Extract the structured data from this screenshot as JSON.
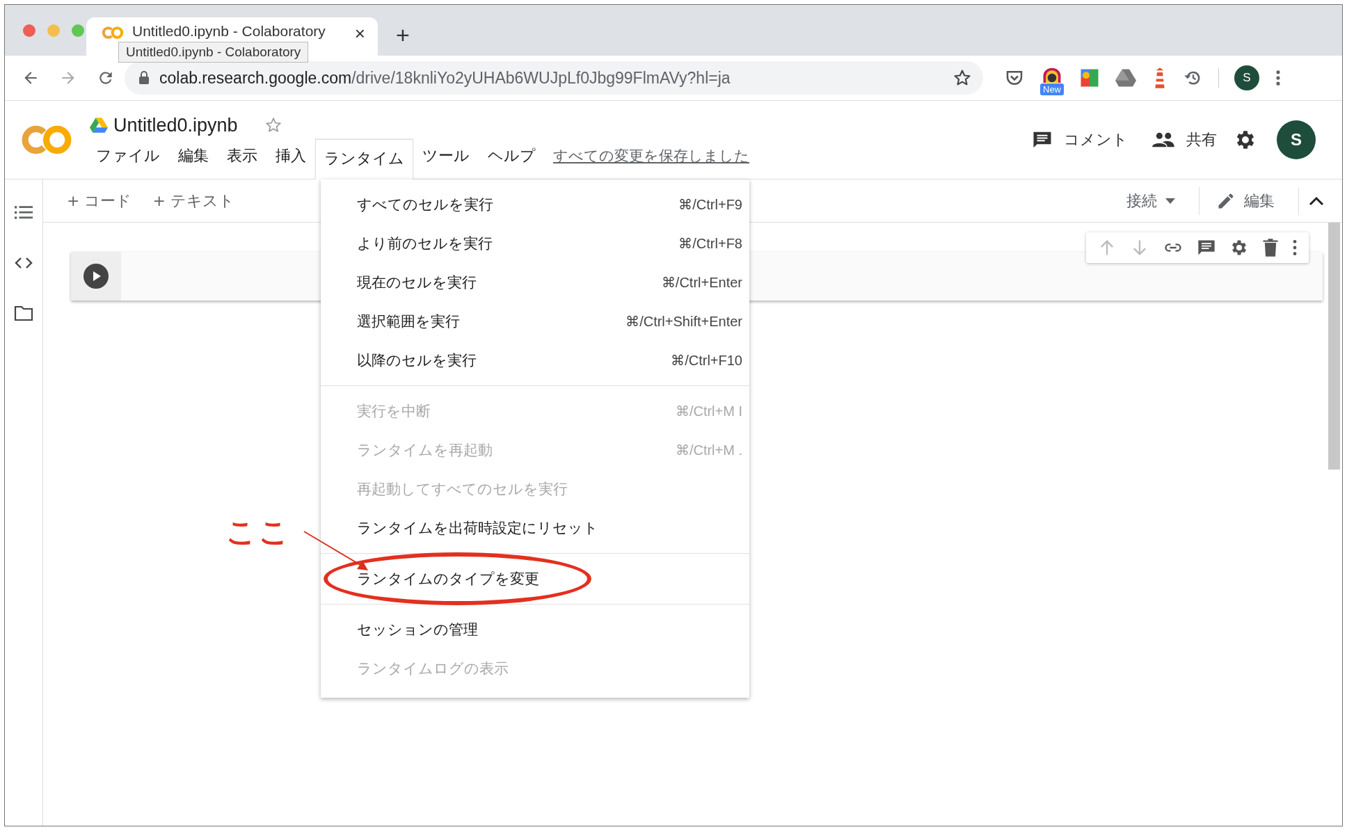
{
  "browser": {
    "tab": {
      "title": "Untitled0.ipynb - Colaboratory",
      "close": "×"
    },
    "new_tab": "+",
    "tooltip": "Untitled0.ipynb - Colaboratory",
    "url": {
      "host": "colab.research.google.com",
      "path": "/drive/18knliYo2yUHAb6WUJpLf0Jbg99FlmAVy?hl=ja"
    },
    "extension_badge": "New",
    "profile_initial": "S"
  },
  "notebook": {
    "title": "Untitled0.ipynb",
    "menus": [
      {
        "label": "ファイル",
        "selected": false
      },
      {
        "label": "編集",
        "selected": false
      },
      {
        "label": "表示",
        "selected": false
      },
      {
        "label": "挿入",
        "selected": false
      },
      {
        "label": "ランタイム",
        "selected": true
      },
      {
        "label": "ツール",
        "selected": false
      },
      {
        "label": "ヘルプ",
        "selected": false
      }
    ],
    "save_status": "すべての変更を保存しました",
    "comment": "コメント",
    "share": "共有",
    "avatar_initial": "S"
  },
  "toolbar": {
    "add_code": "+ コード",
    "add_text": "+ テキスト",
    "connect": "接続",
    "edit": "編集"
  },
  "runtime_menu": {
    "groups": [
      [
        {
          "label": "すべてのセルを実行",
          "shortcut": "⌘/Ctrl+F9",
          "disabled": false,
          "circled": false
        },
        {
          "label": "より前のセルを実行",
          "shortcut": "⌘/Ctrl+F8",
          "disabled": false,
          "circled": false
        },
        {
          "label": "現在のセルを実行",
          "shortcut": "⌘/Ctrl+Enter",
          "disabled": false,
          "circled": false
        },
        {
          "label": "選択範囲を実行",
          "shortcut": "⌘/Ctrl+Shift+Enter",
          "disabled": false,
          "circled": false
        },
        {
          "label": "以降のセルを実行",
          "shortcut": "⌘/Ctrl+F10",
          "disabled": false,
          "circled": false
        }
      ],
      [
        {
          "label": "実行を中断",
          "shortcut": "⌘/Ctrl+M I",
          "disabled": true,
          "circled": false
        },
        {
          "label": "ランタイムを再起動",
          "shortcut": "⌘/Ctrl+M .",
          "disabled": true,
          "circled": false
        },
        {
          "label": "再起動してすべてのセルを実行",
          "disabled": true,
          "circled": false
        },
        {
          "label": "ランタイムを出荷時設定にリセット",
          "disabled": false,
          "circled": false
        }
      ],
      [
        {
          "label": "ランタイムのタイプを変更",
          "disabled": false,
          "circled": true
        }
      ],
      [
        {
          "label": "セッションの管理",
          "disabled": false,
          "circled": false
        },
        {
          "label": "ランタイムログの表示",
          "disabled": true,
          "circled": false
        }
      ]
    ]
  },
  "annotation": {
    "text": "ここ"
  }
}
